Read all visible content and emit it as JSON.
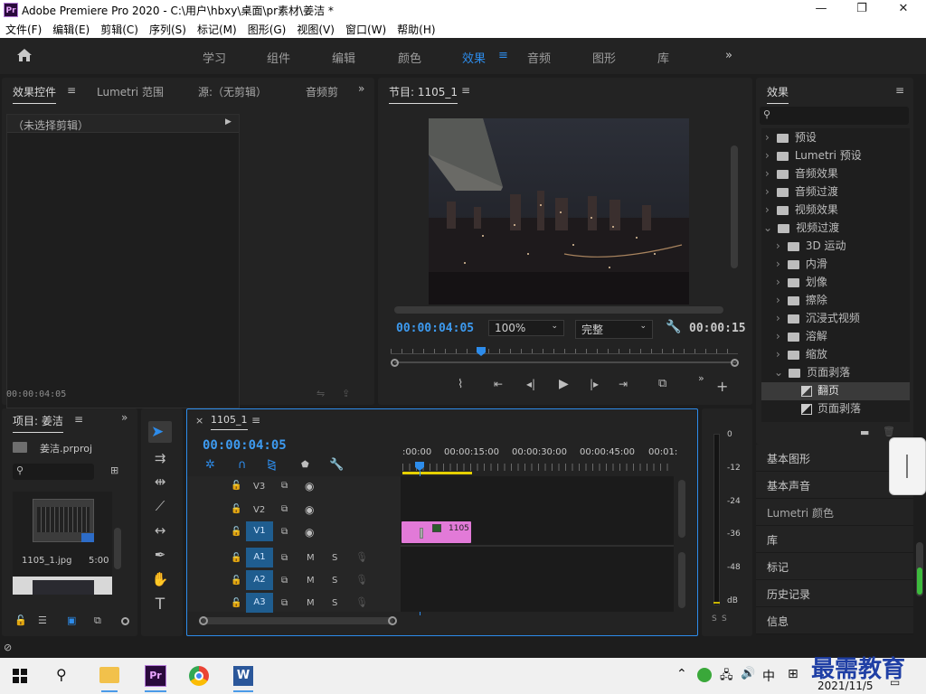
{
  "titlebar": {
    "app_icon": "Pr",
    "title": "Adobe Premiere Pro 2020 - C:\\用户\\hbxy\\桌面\\pr素材\\姜洁 *",
    "min": "—",
    "max": "❐",
    "close": "✕"
  },
  "menu": [
    "文件(F)",
    "编辑(E)",
    "剪辑(C)",
    "序列(S)",
    "标记(M)",
    "图形(G)",
    "视图(V)",
    "窗口(W)",
    "帮助(H)"
  ],
  "workspaces": {
    "items": [
      "学习",
      "组件",
      "编辑",
      "颜色",
      "效果",
      "音频",
      "图形",
      "库"
    ],
    "active": "效果",
    "more": "»"
  },
  "source_panel": {
    "tabs": [
      "效果控件",
      "Lumetri 范围",
      "源:（无剪辑）",
      "音频剪"
    ],
    "no_clip": "（未选择剪辑）",
    "timecode": "00:00:04:05"
  },
  "program": {
    "title": "节目: 1105_1",
    "timecode": "00:00:04:05",
    "zoom": "100%",
    "quality": "完整",
    "duration": "00:00:15"
  },
  "project": {
    "title": "项目: 姜洁",
    "file": "姜洁.prproj",
    "clip_name": "1105_1.jpg",
    "clip_dur": "5:00"
  },
  "timeline": {
    "title": "1105_1",
    "timecode": "00:00:04:05",
    "ruler": [
      ":00:00",
      "00:00:15:00",
      "00:00:30:00",
      "00:00:45:00",
      "00:01:0"
    ],
    "video_tracks": [
      "V3",
      "V2",
      "V1"
    ],
    "audio_tracks": [
      "A1",
      "A2",
      "A3"
    ],
    "audio_m": "M",
    "audio_s": "S",
    "clip_label": "1105"
  },
  "meter": {
    "scale": [
      "0",
      "-12",
      "-24",
      "-36",
      "-48",
      "dB"
    ],
    "s1": "S",
    "s2": "S"
  },
  "effects": {
    "title": "效果",
    "top": [
      "预设",
      "Lumetri 预设",
      "音频效果",
      "音频过渡",
      "视频效果",
      "视频过渡"
    ],
    "sub": [
      "3D 运动",
      "内滑",
      "划像",
      "擦除",
      "沉浸式视频",
      "溶解",
      "缩放",
      "页面剥落"
    ],
    "items": [
      "翻页",
      "页面剥落"
    ]
  },
  "right_panels": [
    "基本图形",
    "基本声音",
    "Lumetri 颜色",
    "库",
    "标记",
    "历史记录",
    "信息"
  ],
  "taskbar": {
    "ime": "中",
    "date": "2021/11/5",
    "watermark": "最需教育"
  }
}
